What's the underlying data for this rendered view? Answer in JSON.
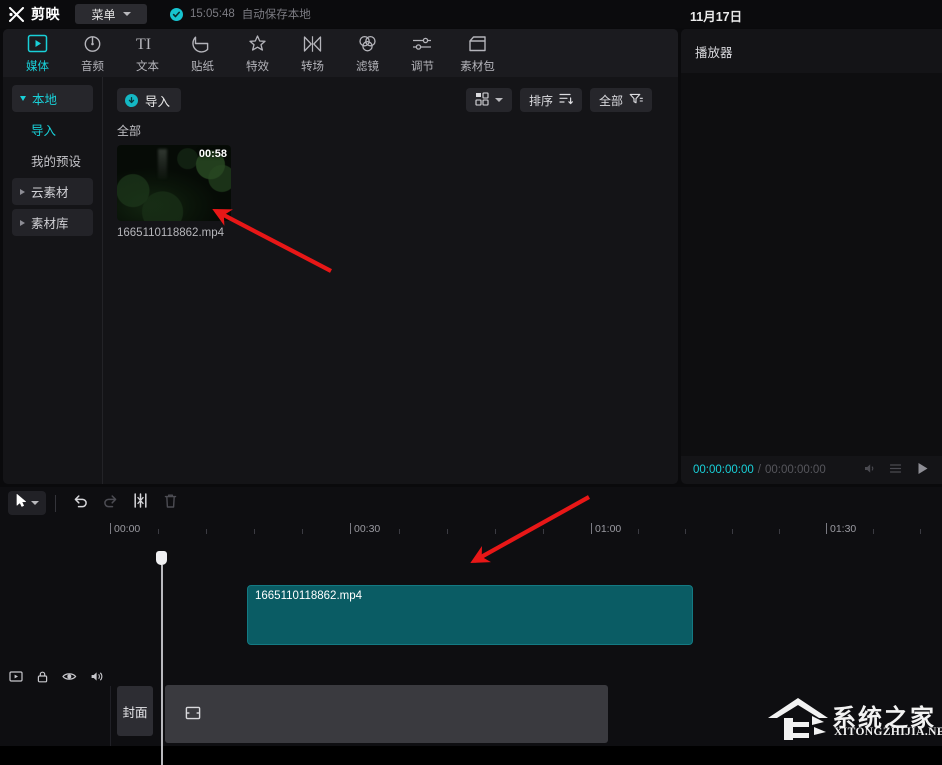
{
  "app": {
    "brand": "剪映",
    "menu_label": "菜单",
    "autosave_time": "15:05:48",
    "autosave_text": "自动保存本地",
    "date": "11月17日",
    "accent_color": "#19d0d8",
    "clip_color": "#0a5c64"
  },
  "tabs": [
    {
      "label": "媒体",
      "icon": "media-icon",
      "active": true
    },
    {
      "label": "音频",
      "icon": "audio-icon",
      "active": false
    },
    {
      "label": "文本",
      "icon": "text-icon",
      "active": false
    },
    {
      "label": "贴纸",
      "icon": "sticker-icon",
      "active": false
    },
    {
      "label": "特效",
      "icon": "effects-icon",
      "active": false
    },
    {
      "label": "转场",
      "icon": "transition-icon",
      "active": false
    },
    {
      "label": "滤镜",
      "icon": "filter-icon",
      "active": false
    },
    {
      "label": "调节",
      "icon": "adjust-icon",
      "active": false
    },
    {
      "label": "素材包",
      "icon": "material-pack-icon",
      "active": false
    }
  ],
  "sidebar": {
    "items": [
      {
        "label": "本地",
        "state": "active"
      },
      {
        "label": "导入",
        "state": "accent"
      },
      {
        "label": "我的预设",
        "state": "normal"
      },
      {
        "label": "云素材",
        "state": "group"
      },
      {
        "label": "素材库",
        "state": "group"
      }
    ]
  },
  "browser": {
    "import_label": "导入",
    "view_mode_icon": "grid-view-icon",
    "sort_label": "排序",
    "filter_label": "全部",
    "section_label": "全部",
    "media": [
      {
        "name": "1665110118862.mp4",
        "duration": "00:58"
      }
    ]
  },
  "player": {
    "title": "播放器",
    "current_time": "00:00:00:00",
    "separator": "/",
    "total_time": "00:00:00:00",
    "icons": [
      "volume-icon",
      "list-icon",
      "play-icon"
    ]
  },
  "timeline": {
    "tools": [
      {
        "name": "select-tool",
        "icon": "cursor-icon",
        "state": "active"
      },
      {
        "name": "undo",
        "icon": "undo-icon",
        "state": "enabled"
      },
      {
        "name": "redo",
        "icon": "redo-icon",
        "state": "disabled"
      },
      {
        "name": "split",
        "icon": "split-icon",
        "state": "enabled"
      },
      {
        "name": "delete",
        "icon": "trash-icon",
        "state": "disabled"
      }
    ],
    "ruler_labels": [
      "00:00",
      "00:30",
      "01:00",
      "01:30"
    ],
    "playhead_time": "00:00",
    "track_icons": [
      "video-icon",
      "lock-icon",
      "eye-icon",
      "speaker-icon"
    ],
    "cover_label": "封面",
    "clip": {
      "label": "1665110118862.mp4"
    }
  },
  "watermark": {
    "cn": "系统之家",
    "en": "XITONGZHIJIA.NET"
  },
  "annotations": [
    {
      "name": "arrow-to-media-thumbnail",
      "color": "#e81717"
    },
    {
      "name": "arrow-to-timeline-clip",
      "color": "#e81717"
    }
  ]
}
